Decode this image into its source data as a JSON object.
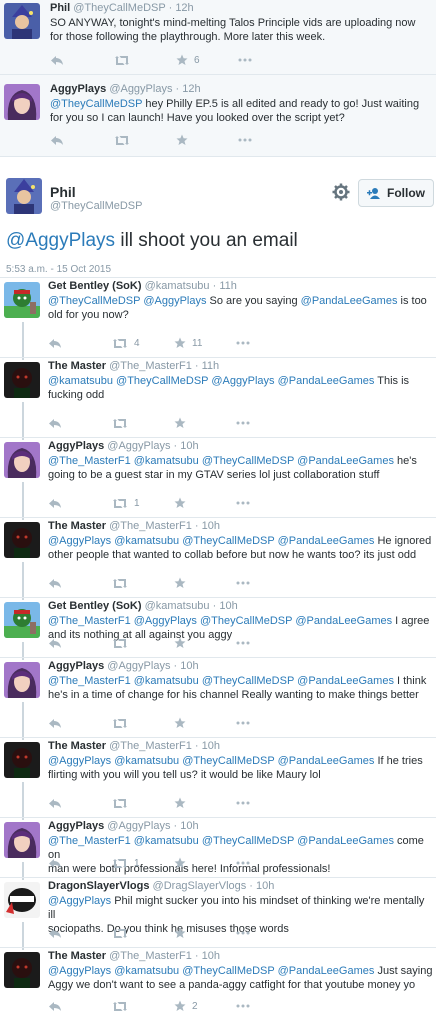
{
  "ancestors": [
    {
      "name": "Phil",
      "handle": "@TheyCallMeDSP",
      "time": "12h",
      "text": "SO ANYWAY, tonight's mind-melting Talos Principle vids are uploading now for those following the playthrough. More later this week.",
      "fav_count": "6"
    },
    {
      "name": "AggyPlays",
      "handle": "@AggyPlays",
      "time": "12h",
      "mention": "@TheyCallMeDSP",
      "text": " hey Philly EP.5 is all edited and ready to go! Just waiting for you so I can launch! Have you looked over the script yet?"
    }
  ],
  "focused": {
    "name": "Phil",
    "handle": "@TheyCallMeDSP",
    "follow_label": "Follow",
    "mention": "@AggyPlays",
    "text": " ill shoot you an email",
    "timestamp": "5:53 a.m. - 15 Oct 2015"
  },
  "replies": [
    {
      "name": "Get Bentley (SoK)",
      "handle": "@kamatsubu",
      "time": "11h",
      "line1": "@TheyCallMeDSP @AggyPlays So are you saying @PandaLeeGames is too",
      "line2": "old for you now?",
      "rt_count": "4",
      "fav_count": "11"
    },
    {
      "name": "The Master",
      "handle": "@The_MasterF1",
      "time": "11h",
      "line1": "@kamatsubu @TheyCallMeDSP @AggyPlays @PandaLeeGames This is",
      "line2": "fucking odd"
    },
    {
      "name": "AggyPlays",
      "handle": "@AggyPlays",
      "time": "10h",
      "line1": "@The_MasterF1 @kamatsubu @TheyCallMeDSP @PandaLeeGames he's",
      "line2": "going to be a guest star in my GTAV series lol just collaboration stuff",
      "rt_count": "1"
    },
    {
      "name": "The Master",
      "handle": "@The_MasterF1",
      "time": "10h",
      "line1": "@AggyPlays @kamatsubu @TheyCallMeDSP @PandaLeeGames He ignored",
      "line2": "other people that wanted to collab before but now he wants too? its just odd"
    },
    {
      "name": "Get Bentley (SoK)",
      "handle": "@kamatsubu",
      "time": "10h",
      "line1": "@The_MasterF1 @AggyPlays @TheyCallMeDSP @PandaLeeGames I agree",
      "line2": "and its nothing at all against you aggy"
    },
    {
      "name": "AggyPlays",
      "handle": "@AggyPlays",
      "time": "10h",
      "line1": "@The_MasterF1 @kamatsubu @TheyCallMeDSP @PandaLeeGames I think",
      "line2": "he's in a time of change for his channel Really wanting to make things better"
    },
    {
      "name": "The Master",
      "handle": "@The_MasterF1",
      "time": "10h",
      "line1": "@AggyPlays @kamatsubu @TheyCallMeDSP @PandaLeeGames If he tries",
      "line2": "flirting with you will you tell us? it would be like Maury lol"
    },
    {
      "name": "AggyPlays",
      "handle": "@AggyPlays",
      "time": "10h",
      "line1": "@The_MasterF1 @kamatsubu @TheyCallMeDSP @PandaLeeGames come on",
      "line2": "man were both professionals here! Informal professionals!",
      "rt_count": "1"
    },
    {
      "name": "DragonSlayerVlogs",
      "handle": "@DragSlayerVlogs",
      "time": "10h",
      "line1": "@AggyPlays Phil might sucker you into his mindset of thinking we're mentally ill",
      "line2": "sociopaths. Do you think he misuses those words"
    },
    {
      "name": "The Master",
      "handle": "@The_MasterF1",
      "time": "10h",
      "line1": "@AggyPlays @kamatsubu @TheyCallMeDSP @PandaLeeGames Just saying",
      "line2": "Aggy we don't want to see a panda-aggy catfight for that youtube money yo",
      "fav_count": "2"
    }
  ],
  "colors": {
    "link": "#2b7bb9",
    "muted": "#8899a6",
    "icon": "#aab8c2",
    "thread_bg": "#f5f8fa"
  }
}
